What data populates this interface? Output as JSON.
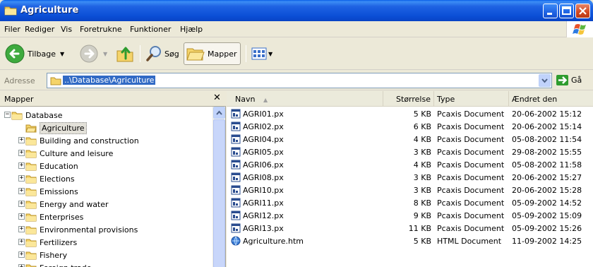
{
  "window": {
    "title": "Agriculture"
  },
  "menu": {
    "items": [
      {
        "label": "Filer"
      },
      {
        "label": "Rediger"
      },
      {
        "label": "Vis"
      },
      {
        "label": "Foretrukne"
      },
      {
        "label": "Funktioner"
      },
      {
        "label": "Hjælp"
      }
    ]
  },
  "toolbar": {
    "back_label": "Tilbage",
    "search_label": "Søg",
    "folders_label": "Mapper"
  },
  "address": {
    "label": "Adresse",
    "value": "..\\Database\\Agriculture",
    "go_label": "Gå"
  },
  "folders_pane": {
    "title": "Mapper",
    "close_glyph": "✕",
    "tree": [
      {
        "label": "Database",
        "level": 0,
        "expander": "−",
        "selected": false
      },
      {
        "label": "Agriculture",
        "level": 1,
        "expander": "",
        "selected": true
      },
      {
        "label": "Building and construction",
        "level": 1,
        "expander": "+",
        "selected": false
      },
      {
        "label": "Culture and leisure",
        "level": 1,
        "expander": "+",
        "selected": false
      },
      {
        "label": "Education",
        "level": 1,
        "expander": "+",
        "selected": false
      },
      {
        "label": "Elections",
        "level": 1,
        "expander": "+",
        "selected": false
      },
      {
        "label": "Emissions",
        "level": 1,
        "expander": "+",
        "selected": false
      },
      {
        "label": "Energy and water",
        "level": 1,
        "expander": "+",
        "selected": false
      },
      {
        "label": "Enterprises",
        "level": 1,
        "expander": "+",
        "selected": false
      },
      {
        "label": "Environmental provisions",
        "level": 1,
        "expander": "+",
        "selected": false
      },
      {
        "label": "Fertilizers",
        "level": 1,
        "expander": "+",
        "selected": false
      },
      {
        "label": "Fishery",
        "level": 1,
        "expander": "+",
        "selected": false
      },
      {
        "label": "Foreign trade",
        "level": 1,
        "expander": "+",
        "selected": false
      }
    ]
  },
  "file_list": {
    "columns": {
      "name": "Navn",
      "size": "Størrelse",
      "type": "Type",
      "modified": "Ændret den"
    },
    "sort_indicator": "▲",
    "rows": [
      {
        "name": "AGRI01.px",
        "size": "5 KB",
        "type": "Pcaxis Document",
        "modified": "20-06-2002 15:12",
        "icon": "pcaxis-file-icon"
      },
      {
        "name": "AGRI02.px",
        "size": "6 KB",
        "type": "Pcaxis Document",
        "modified": "20-06-2002 15:14",
        "icon": "pcaxis-file-icon"
      },
      {
        "name": "AGRI04.px",
        "size": "4 KB",
        "type": "Pcaxis Document",
        "modified": "05-08-2002 11:54",
        "icon": "pcaxis-file-icon"
      },
      {
        "name": "AGRI05.px",
        "size": "3 KB",
        "type": "Pcaxis Document",
        "modified": "29-08-2002 15:55",
        "icon": "pcaxis-file-icon"
      },
      {
        "name": "AGRI06.px",
        "size": "4 KB",
        "type": "Pcaxis Document",
        "modified": "05-08-2002 11:58",
        "icon": "pcaxis-file-icon"
      },
      {
        "name": "AGRI08.px",
        "size": "3 KB",
        "type": "Pcaxis Document",
        "modified": "20-06-2002 15:27",
        "icon": "pcaxis-file-icon"
      },
      {
        "name": "AGRI10.px",
        "size": "3 KB",
        "type": "Pcaxis Document",
        "modified": "20-06-2002 15:28",
        "icon": "pcaxis-file-icon"
      },
      {
        "name": "AGRI11.px",
        "size": "8 KB",
        "type": "Pcaxis Document",
        "modified": "05-09-2002 14:52",
        "icon": "pcaxis-file-icon"
      },
      {
        "name": "AGRI12.px",
        "size": "9 KB",
        "type": "Pcaxis Document",
        "modified": "05-09-2002 15:09",
        "icon": "pcaxis-file-icon"
      },
      {
        "name": "AGRI13.px",
        "size": "11 KB",
        "type": "Pcaxis Document",
        "modified": "05-09-2002 15:26",
        "icon": "pcaxis-file-icon"
      },
      {
        "name": "Agriculture.htm",
        "size": "5 KB",
        "type": "HTML Document",
        "modified": "11-09-2002 14:25",
        "icon": "html-file-icon"
      }
    ]
  },
  "colors": {
    "titlebar": "#0B4FD6",
    "selection": "#316AC5",
    "chrome": "#ECE9D8",
    "folder": "#F5D46A"
  }
}
